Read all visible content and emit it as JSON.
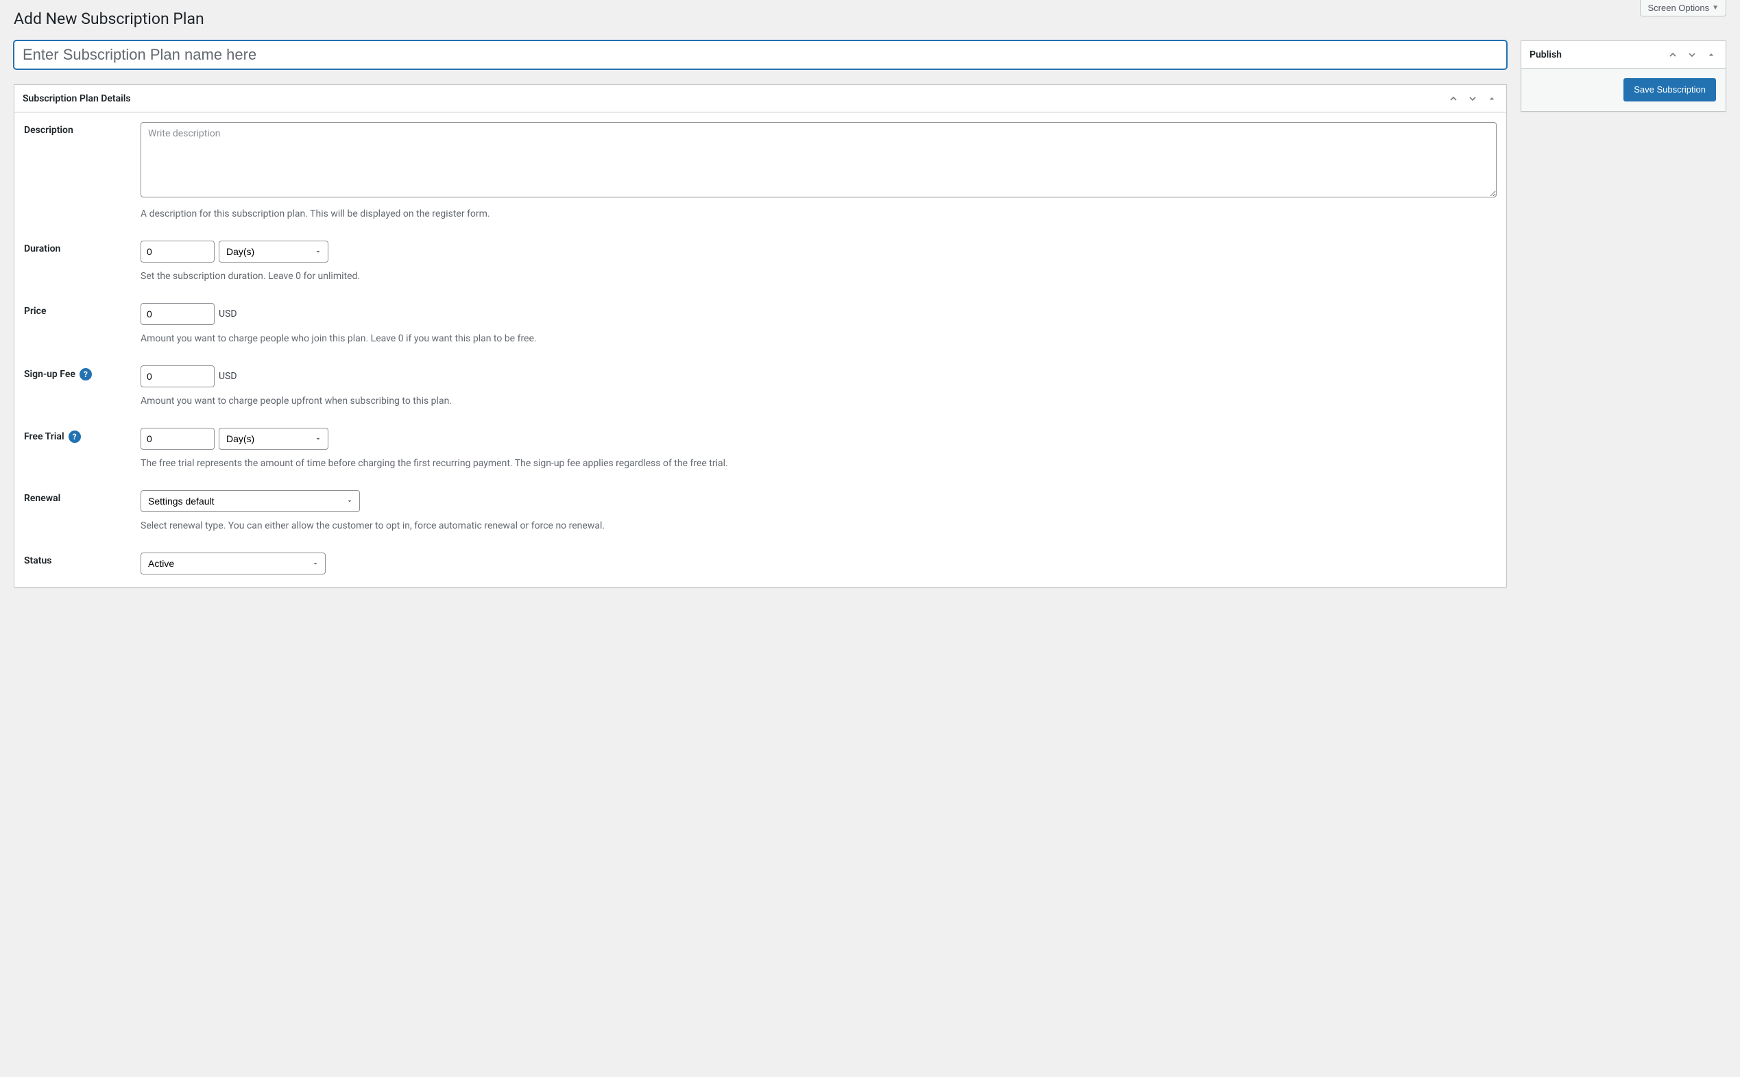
{
  "screenOptions": {
    "label": "Screen Options"
  },
  "page": {
    "title": "Add New Subscription Plan"
  },
  "titleInput": {
    "placeholder": "Enter Subscription Plan name here",
    "value": ""
  },
  "detailsBox": {
    "title": "Subscription Plan Details"
  },
  "publishBox": {
    "title": "Publish",
    "saveButton": "Save Subscription"
  },
  "fields": {
    "description": {
      "label": "Description",
      "placeholder": "Write description",
      "value": "",
      "help": "A description for this subscription plan. This will be displayed on the register form."
    },
    "duration": {
      "label": "Duration",
      "value": "0",
      "unit": "Day(s)",
      "help": "Set the subscription duration. Leave 0 for unlimited."
    },
    "price": {
      "label": "Price",
      "value": "0",
      "currency": "USD",
      "help": "Amount you want to charge people who join this plan. Leave 0 if you want this plan to be free."
    },
    "signupFee": {
      "label": "Sign-up Fee",
      "value": "0",
      "currency": "USD",
      "help": "Amount you want to charge people upfront when subscribing to this plan."
    },
    "freeTrial": {
      "label": "Free Trial",
      "value": "0",
      "unit": "Day(s)",
      "help": "The free trial represents the amount of time before charging the first recurring payment. The sign-up fee applies regardless of the free trial."
    },
    "renewal": {
      "label": "Renewal",
      "selected": "Settings default",
      "help": "Select renewal type. You can either allow the customer to opt in, force automatic renewal or force no renewal."
    },
    "status": {
      "label": "Status",
      "selected": "Active"
    }
  }
}
